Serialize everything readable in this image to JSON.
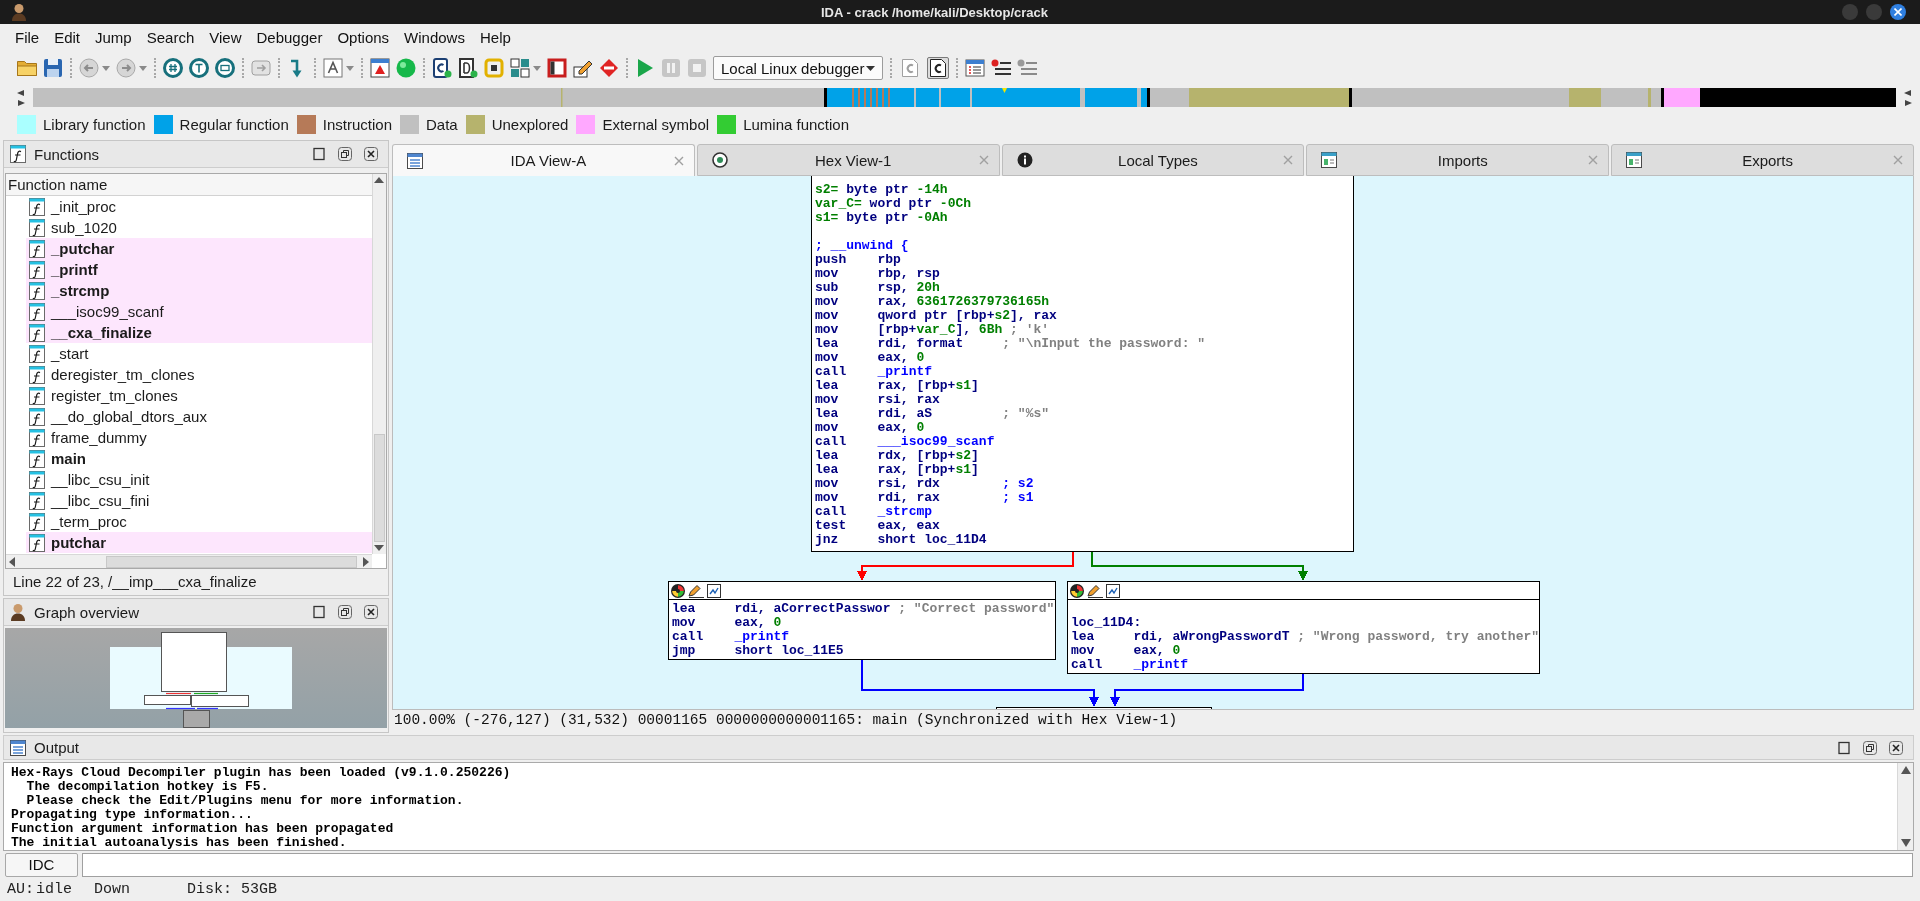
{
  "window": {
    "title": "IDA - crack /home/kali/Desktop/crack"
  },
  "menu": [
    "File",
    "Edit",
    "Jump",
    "Search",
    "View",
    "Debugger",
    "Options",
    "Windows",
    "Help"
  ],
  "toolbar": {
    "debugger": "Local Linux debugger",
    "toggles": [
      {
        "on": false
      },
      {
        "on": true
      }
    ]
  },
  "legend": [
    {
      "label": "Library function",
      "color": "#aaffff"
    },
    {
      "label": "Regular function",
      "color": "#00a2e8"
    },
    {
      "label": "Instruction",
      "color": "#b67a58"
    },
    {
      "label": "Data",
      "color": "#c0c0c0"
    },
    {
      "label": "Unexplored",
      "color": "#b6b36d"
    },
    {
      "label": "External symbol",
      "color": "#ffa8ff"
    },
    {
      "label": "Lumina function",
      "color": "#33cc33"
    }
  ],
  "functions_panel": {
    "title": "Functions",
    "column": "Function name",
    "rows": [
      {
        "name": "_init_proc",
        "external": false,
        "bold": false
      },
      {
        "name": "sub_1020",
        "external": false,
        "bold": false
      },
      {
        "name": "_putchar",
        "external": true,
        "bold": true
      },
      {
        "name": "_printf",
        "external": true,
        "bold": true
      },
      {
        "name": "_strcmp",
        "external": true,
        "bold": true
      },
      {
        "name": "___isoc99_scanf",
        "external": true,
        "bold": false
      },
      {
        "name": "__cxa_finalize",
        "external": true,
        "bold": true
      },
      {
        "name": "_start",
        "external": false,
        "bold": false
      },
      {
        "name": "deregister_tm_clones",
        "external": false,
        "bold": false
      },
      {
        "name": "register_tm_clones",
        "external": false,
        "bold": false
      },
      {
        "name": "__do_global_dtors_aux",
        "external": false,
        "bold": false
      },
      {
        "name": "frame_dummy",
        "external": false,
        "bold": false
      },
      {
        "name": "main",
        "external": false,
        "bold": true
      },
      {
        "name": "__libc_csu_init",
        "external": false,
        "bold": false
      },
      {
        "name": "__libc_csu_fini",
        "external": false,
        "bold": false
      },
      {
        "name": "_term_proc",
        "external": false,
        "bold": false
      },
      {
        "name": "putchar",
        "external": true,
        "bold": true
      }
    ],
    "line_info": "Line 22 of 23, /__imp___cxa_finalize"
  },
  "graph_overview": {
    "title": "Graph overview"
  },
  "tabs": [
    {
      "label": "IDA View-A",
      "selected": true
    },
    {
      "label": "Hex View-1",
      "selected": false
    },
    {
      "label": "Local Types",
      "selected": false
    },
    {
      "label": "Imports",
      "selected": false
    },
    {
      "label": "Exports",
      "selected": false
    }
  ],
  "graph": {
    "nodes": [
      {
        "header": false,
        "lines": [
          {
            "kind": "code",
            "segments": [
              {
                "kind": "value",
                "text": "s2="
              },
              {
                "kind": "ins",
                "text": " byte ptr "
              },
              {
                "kind": "value",
                "text": "-14h"
              }
            ]
          },
          {
            "kind": "code",
            "segments": [
              {
                "kind": "value",
                "text": "var_C="
              },
              {
                "kind": "ins",
                "text": " word ptr "
              },
              {
                "kind": "value",
                "text": "-0Ch"
              }
            ]
          },
          {
            "kind": "code",
            "segments": [
              {
                "kind": "value",
                "text": "s1="
              },
              {
                "kind": "ins",
                "text": " byte ptr "
              },
              {
                "kind": "value",
                "text": "-0Ah"
              }
            ]
          },
          {
            "kind": "blank"
          },
          {
            "kind": "code",
            "segments": [
              {
                "kind": "cmt",
                "text": "; __unwind {"
              }
            ]
          },
          {
            "kind": "code",
            "segments": [
              {
                "kind": "ins",
                "text": "push    rbp"
              }
            ]
          },
          {
            "kind": "code",
            "segments": [
              {
                "kind": "ins",
                "text": "mov     rbp, rsp"
              }
            ]
          },
          {
            "kind": "code",
            "segments": [
              {
                "kind": "ins",
                "text": "sub     rsp, "
              },
              {
                "kind": "value",
                "text": "20h"
              }
            ]
          },
          {
            "kind": "code",
            "segments": [
              {
                "kind": "ins",
                "text": "mov     rax, "
              },
              {
                "kind": "value",
                "text": "6361726379736165h"
              }
            ]
          },
          {
            "kind": "code",
            "segments": [
              {
                "kind": "ins",
                "text": "mov     qword ptr [rbp+"
              },
              {
                "kind": "value",
                "text": "s2"
              },
              {
                "kind": "ins",
                "text": "], rax"
              }
            ]
          },
          {
            "kind": "code",
            "segments": [
              {
                "kind": "ins",
                "text": "mov     [rbp+"
              },
              {
                "kind": "value",
                "text": "var_C"
              },
              {
                "kind": "ins",
                "text": "], "
              },
              {
                "kind": "value",
                "text": "6Bh"
              },
              {
                "kind": "str",
                "text": " ; 'k'"
              }
            ]
          },
          {
            "kind": "code",
            "segments": [
              {
                "kind": "ins",
                "text": "lea     rdi, format"
              },
              {
                "kind": "str",
                "text": "     ; \"\\nInput the password: \""
              }
            ]
          },
          {
            "kind": "code",
            "segments": [
              {
                "kind": "ins",
                "text": "mov     eax, "
              },
              {
                "kind": "value",
                "text": "0"
              }
            ]
          },
          {
            "kind": "code",
            "segments": [
              {
                "kind": "ins",
                "text": "call    "
              },
              {
                "kind": "func",
                "text": "_printf"
              }
            ]
          },
          {
            "kind": "code",
            "segments": [
              {
                "kind": "ins",
                "text": "lea     rax, [rbp+"
              },
              {
                "kind": "value",
                "text": "s1"
              },
              {
                "kind": "ins",
                "text": "]"
              }
            ]
          },
          {
            "kind": "code",
            "segments": [
              {
                "kind": "ins",
                "text": "mov     rsi, rax"
              }
            ]
          },
          {
            "kind": "code",
            "segments": [
              {
                "kind": "ins",
                "text": "lea     rdi, aS"
              },
              {
                "kind": "str",
                "text": "         ; \"%s\""
              }
            ]
          },
          {
            "kind": "code",
            "segments": [
              {
                "kind": "ins",
                "text": "mov     eax, "
              },
              {
                "kind": "value",
                "text": "0"
              }
            ]
          },
          {
            "kind": "code",
            "segments": [
              {
                "kind": "ins",
                "text": "call    "
              },
              {
                "kind": "func",
                "text": "___isoc99_scanf"
              }
            ]
          },
          {
            "kind": "code",
            "segments": [
              {
                "kind": "ins",
                "text": "lea     rdx, [rbp+"
              },
              {
                "kind": "value",
                "text": "s2"
              },
              {
                "kind": "ins",
                "text": "]"
              }
            ]
          },
          {
            "kind": "code",
            "segments": [
              {
                "kind": "ins",
                "text": "lea     rax, [rbp+"
              },
              {
                "kind": "value",
                "text": "s1"
              },
              {
                "kind": "ins",
                "text": "]"
              }
            ]
          },
          {
            "kind": "code",
            "segments": [
              {
                "kind": "ins",
                "text": "mov     rsi, rdx"
              },
              {
                "kind": "cmt",
                "text": "        ; s2"
              }
            ]
          },
          {
            "kind": "code",
            "segments": [
              {
                "kind": "ins",
                "text": "mov     rdi, rax"
              },
              {
                "kind": "cmt",
                "text": "        ; s1"
              }
            ]
          },
          {
            "kind": "code",
            "segments": [
              {
                "kind": "ins",
                "text": "call    "
              },
              {
                "kind": "func",
                "text": "_strcmp"
              }
            ]
          },
          {
            "kind": "code",
            "segments": [
              {
                "kind": "ins",
                "text": "test    eax, eax"
              }
            ]
          },
          {
            "kind": "code",
            "segments": [
              {
                "kind": "ins",
                "text": "jnz     short loc_11D4"
              }
            ]
          }
        ]
      },
      {
        "header": true,
        "lines": [
          {
            "kind": "code",
            "segments": [
              {
                "kind": "ins",
                "text": "lea     rdi, aCorrectPasswor"
              },
              {
                "kind": "str",
                "text": " ; \"Correct password\""
              }
            ]
          },
          {
            "kind": "code",
            "segments": [
              {
                "kind": "ins",
                "text": "mov     eax, "
              },
              {
                "kind": "value",
                "text": "0"
              }
            ]
          },
          {
            "kind": "code",
            "segments": [
              {
                "kind": "ins",
                "text": "call    "
              },
              {
                "kind": "func",
                "text": "_printf"
              }
            ]
          },
          {
            "kind": "code",
            "segments": [
              {
                "kind": "ins",
                "text": "jmp     short loc_11E5"
              }
            ]
          }
        ]
      },
      {
        "header": true,
        "lines": [
          {
            "kind": "blank"
          },
          {
            "kind": "code",
            "segments": [
              {
                "kind": "ins",
                "text": "loc_11D4:"
              }
            ]
          },
          {
            "kind": "code",
            "segments": [
              {
                "kind": "ins",
                "text": "lea     rdi, aWrongPasswordT"
              },
              {
                "kind": "str",
                "text": " ; \"Wrong password, try another\""
              }
            ]
          },
          {
            "kind": "code",
            "segments": [
              {
                "kind": "ins",
                "text": "mov     eax, "
              },
              {
                "kind": "value",
                "text": "0"
              }
            ]
          },
          {
            "kind": "code",
            "segments": [
              {
                "kind": "ins",
                "text": "call    "
              },
              {
                "kind": "func",
                "text": "_printf"
              }
            ]
          }
        ]
      }
    ],
    "edges": [
      {
        "color": "#ff0000"
      },
      {
        "color": "#008000"
      },
      {
        "color": "#0000ff"
      },
      {
        "color": "#0000ff"
      }
    ],
    "status": "100.00% (-276,127) (31,532) 00001165 0000000000001165: main (Synchronized with Hex View-1)"
  },
  "output": {
    "title": "Output",
    "lines": [
      "Hex-Rays Cloud Decompiler plugin has been loaded (v9.1.0.250226)",
      "  The decompilation hotkey is F5.",
      "  Please check the Edit/Plugins menu for more information.",
      "Propagating type information...",
      "Function argument information has been propagated",
      "The initial autoanalysis has been finished."
    ]
  },
  "command_line": {
    "interpreter": "IDC"
  },
  "status_bar": {
    "analysis_label": "AU:",
    "analysis_state": "idle",
    "direction": "Down",
    "disk": "Disk: 53GB"
  }
}
